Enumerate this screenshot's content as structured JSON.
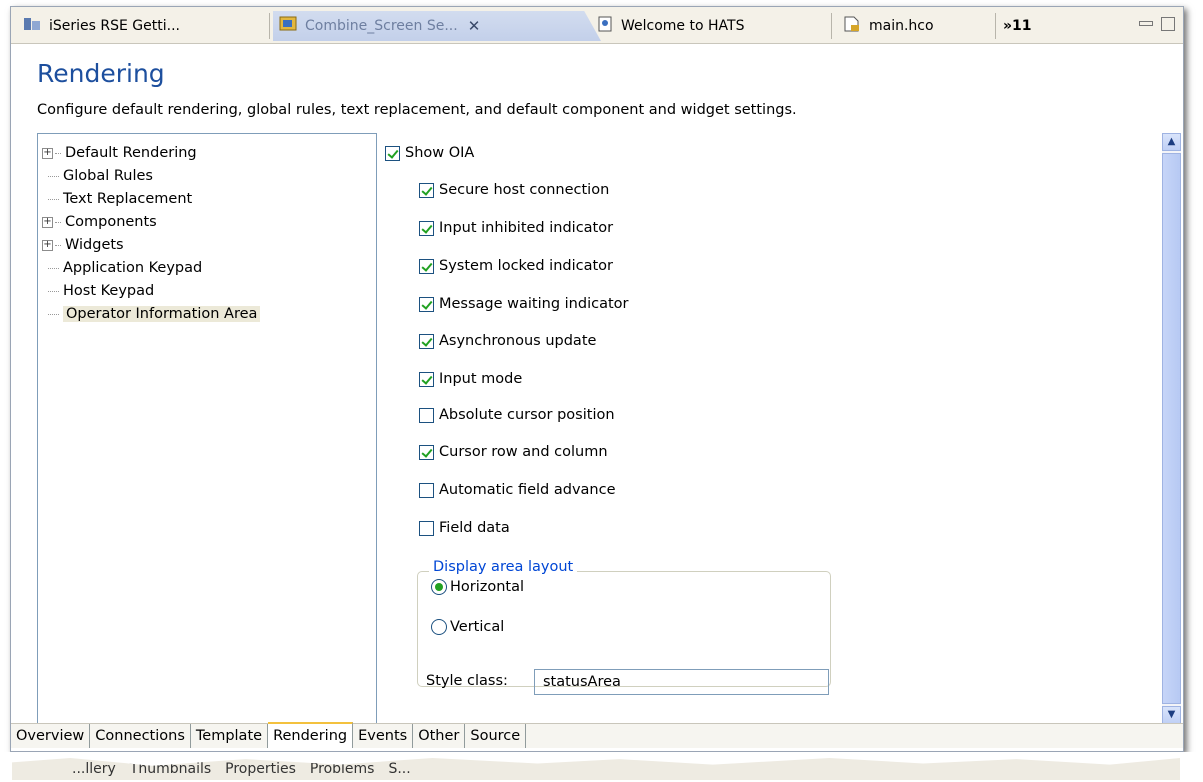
{
  "tabs": [
    {
      "label": "iSeries RSE Getti...",
      "active": false
    },
    {
      "label": "Combine_Screen Se...",
      "active": true
    },
    {
      "label": "Welcome to HATS",
      "active": false
    },
    {
      "label": "main.hco",
      "active": false
    }
  ],
  "overflow_tabs": "»11",
  "page": {
    "title": "Rendering",
    "description": "Configure default rendering, global rules, text replacement, and default component and widget settings."
  },
  "tree": [
    {
      "label": "Default Rendering",
      "expandable": true
    },
    {
      "label": "Global Rules",
      "expandable": false
    },
    {
      "label": "Text Replacement",
      "expandable": false
    },
    {
      "label": "Components",
      "expandable": true
    },
    {
      "label": "Widgets",
      "expandable": true
    },
    {
      "label": "Application Keypad",
      "expandable": false
    },
    {
      "label": "Host Keypad",
      "expandable": false
    },
    {
      "label": "Operator Information Area",
      "expandable": false,
      "selected": true
    }
  ],
  "show_oia": {
    "label": "Show OIA",
    "checked": true
  },
  "options": [
    {
      "label": "Secure host connection",
      "checked": true
    },
    {
      "label": "Input inhibited indicator",
      "checked": true
    },
    {
      "label": "System locked indicator",
      "checked": true
    },
    {
      "label": "Message waiting indicator",
      "checked": true
    },
    {
      "label": "Asynchronous update",
      "checked": true
    },
    {
      "label": "Input mode",
      "checked": true
    },
    {
      "label": "Absolute cursor position",
      "checked": false
    },
    {
      "label": "Cursor row and column",
      "checked": true
    },
    {
      "label": "Automatic field advance",
      "checked": false
    },
    {
      "label": "Field data",
      "checked": false
    }
  ],
  "layout_group": {
    "label": "Display area layout",
    "options": [
      {
        "label": "Horizontal",
        "selected": true
      },
      {
        "label": "Vertical",
        "selected": false
      }
    ]
  },
  "style_class": {
    "label": "Style class:",
    "value": "statusArea"
  },
  "bottom_tabs": [
    "Overview",
    "Connections",
    "Template",
    "Rendering",
    "Events",
    "Other",
    "Source"
  ],
  "active_bottom_tab": "Rendering",
  "lower_tabs": [
    "...llery",
    "Thumbnails",
    "Properties",
    "Problems",
    "S..."
  ]
}
